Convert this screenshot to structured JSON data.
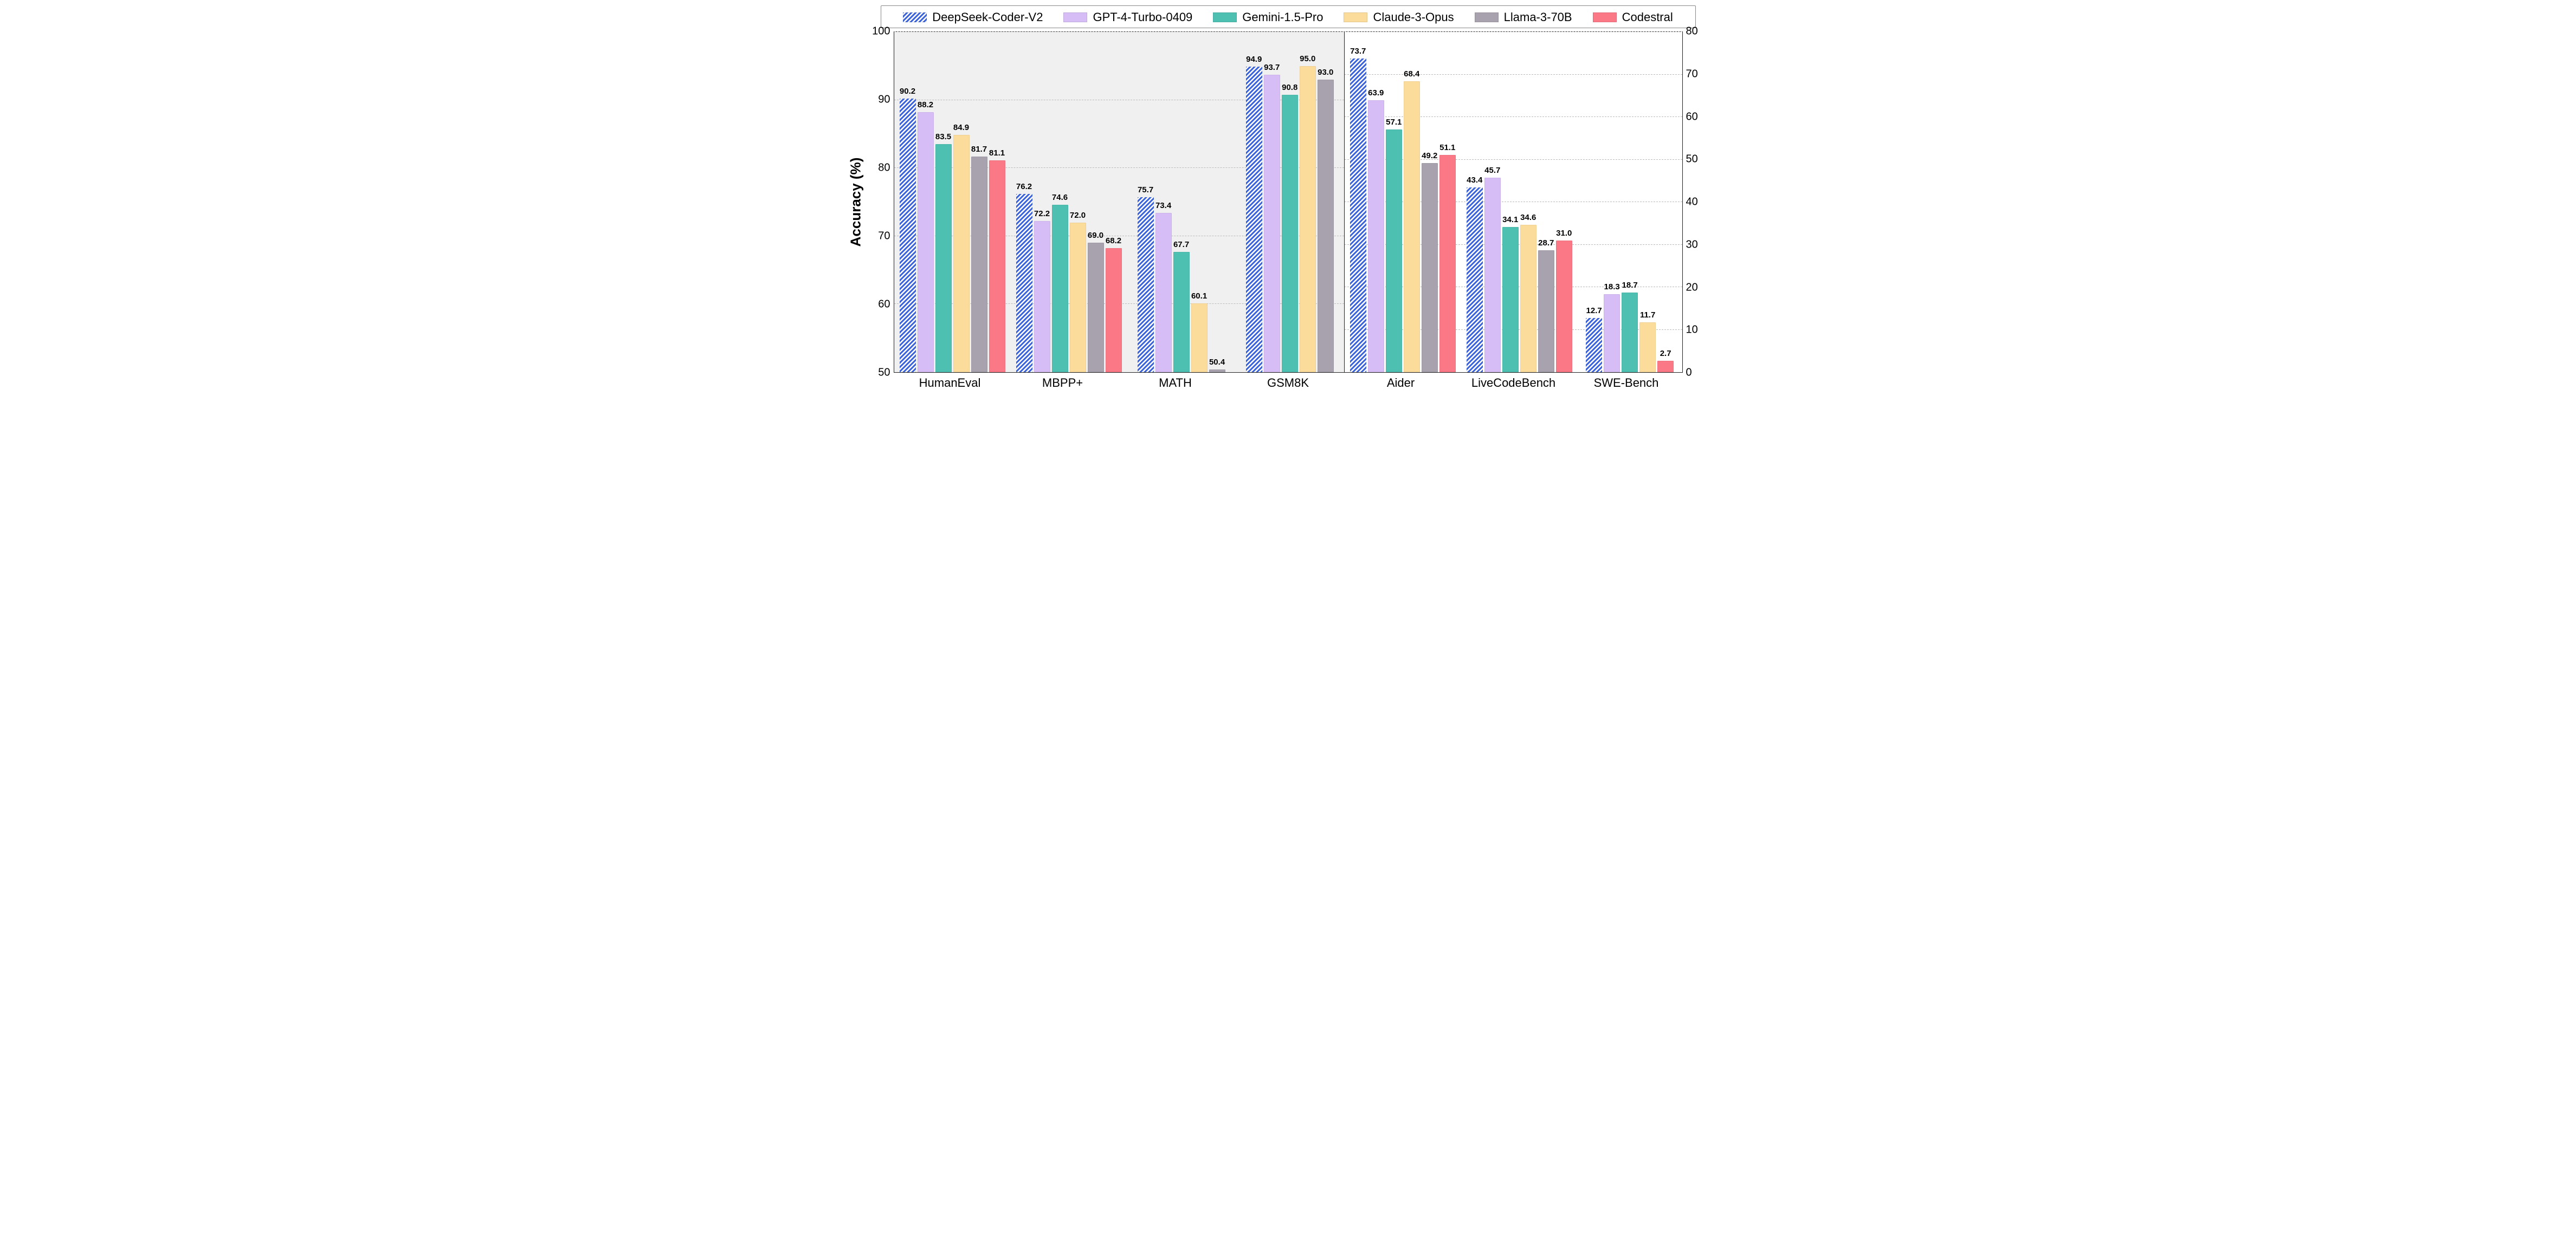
{
  "chart_data": {
    "type": "bar",
    "ylabel": "Accuracy (%)",
    "panels": [
      {
        "categories": [
          "HumanEval",
          "MBPP+",
          "MATH",
          "GSM8K"
        ],
        "ylim": [
          50,
          100
        ],
        "yticks": [
          50,
          60,
          70,
          80,
          90,
          100
        ]
      },
      {
        "categories": [
          "Aider",
          "LiveCodeBench",
          "SWE-Bench"
        ],
        "ylim": [
          0,
          80
        ],
        "yticks": [
          0,
          10,
          20,
          30,
          40,
          50,
          60,
          70,
          80
        ]
      }
    ],
    "series": [
      {
        "name": "DeepSeek-Coder-V2",
        "color": "#3a62d8",
        "hatched": true
      },
      {
        "name": "GPT-4-Turbo-0409",
        "color": "#d6bdf6",
        "hatched": false
      },
      {
        "name": "Gemini-1.5-Pro",
        "color": "#4ec0b1",
        "hatched": false
      },
      {
        "name": "Claude-3-Opus",
        "color": "#fcdc9a",
        "hatched": false
      },
      {
        "name": "Llama-3-70B",
        "color": "#a7a2ad",
        "hatched": false
      },
      {
        "name": "Codestral",
        "color": "#fb7886",
        "hatched": false
      }
    ],
    "data": {
      "HumanEval": [
        90.2,
        88.2,
        83.5,
        84.9,
        81.7,
        81.1
      ],
      "MBPP+": [
        76.2,
        72.2,
        74.6,
        72.0,
        69.0,
        68.2
      ],
      "MATH": [
        75.7,
        73.4,
        67.7,
        60.1,
        50.4,
        null
      ],
      "GSM8K": [
        94.9,
        93.7,
        90.8,
        95.0,
        93.0,
        null
      ],
      "Aider": [
        73.7,
        63.9,
        57.1,
        68.4,
        49.2,
        51.1
      ],
      "LiveCodeBench": [
        43.4,
        45.7,
        34.1,
        34.6,
        28.7,
        31.0
      ],
      "SWE-Bench": [
        12.7,
        18.3,
        18.7,
        11.7,
        null,
        2.7
      ]
    }
  }
}
